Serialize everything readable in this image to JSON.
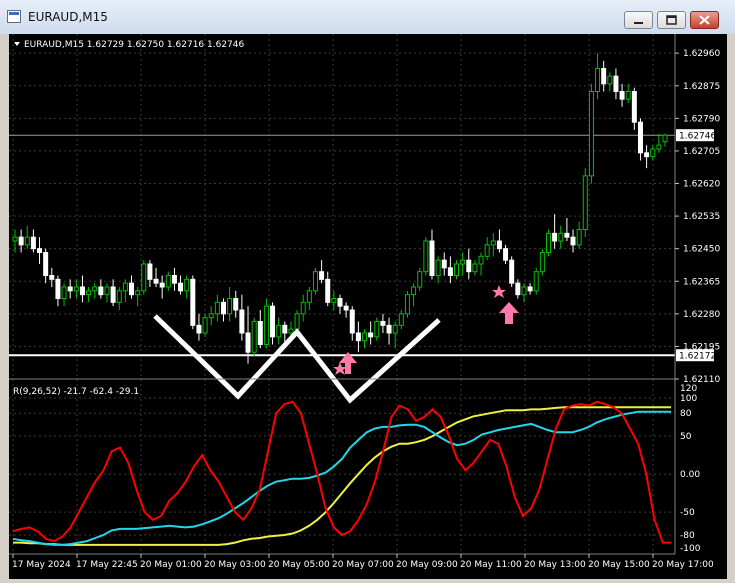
{
  "window": {
    "title": "EURAUD,M15"
  },
  "header": {
    "symbol_line": "EURAUD,M15  1.62729 1.62750 1.62716 1.62746"
  },
  "price_axis": {
    "labels": [
      "1.62960",
      "1.62875",
      "1.62790",
      "1.62705",
      "1.62620",
      "1.62535",
      "1.62450",
      "1.62365",
      "1.62280",
      "1.62195",
      "1.62110"
    ],
    "current_price": "1.62746",
    "line_price": "1.62172"
  },
  "indicator": {
    "header": "R(9,26,52) -21.7 -62.4 -29.1",
    "axis_labels": [
      "120",
      "100",
      "80",
      "50",
      "0.00",
      "-50",
      "-80",
      "-100"
    ]
  },
  "time_axis": {
    "labels": [
      "17 May 2024",
      "17 May 22:45",
      "20 May 01:00",
      "20 May 03:00",
      "20 May 05:00",
      "20 May 07:00",
      "20 May 09:00",
      "20 May 11:00",
      "20 May 13:00",
      "20 May 15:00",
      "20 May 17:00"
    ]
  },
  "colors": {
    "background": "#000000",
    "bull_candle": "#00c000",
    "bear_candle": "#ffffff",
    "grid": "#3a3a3a",
    "series_red": "#ff0000",
    "series_cyan": "#20d8e8",
    "series_yellow": "#f0f040",
    "arrow": "#ff7aa8"
  },
  "chart_data": [
    {
      "type": "candlestick",
      "title": "EURAUD,M15",
      "ylim": [
        1.6211,
        1.6301
      ],
      "ohlc": [
        [
          1.6247,
          1.625,
          1.6244,
          1.6248
        ],
        [
          1.6248,
          1.625,
          1.6244,
          1.6246
        ],
        [
          1.6246,
          1.6251,
          1.6245,
          1.6248
        ],
        [
          1.6248,
          1.625,
          1.6244,
          1.6245
        ],
        [
          1.6245,
          1.6248,
          1.6241,
          1.6244
        ],
        [
          1.6244,
          1.6245,
          1.6236,
          1.6238
        ],
        [
          1.6238,
          1.624,
          1.6235,
          1.6237
        ],
        [
          1.6237,
          1.6238,
          1.623,
          1.6232
        ],
        [
          1.6232,
          1.6236,
          1.623,
          1.6235
        ],
        [
          1.6235,
          1.6237,
          1.6232,
          1.6234
        ],
        [
          1.6234,
          1.6237,
          1.6232,
          1.6235
        ],
        [
          1.6235,
          1.6238,
          1.6231,
          1.6233
        ],
        [
          1.6233,
          1.6235,
          1.6231,
          1.6234
        ],
        [
          1.6234,
          1.6236,
          1.6232,
          1.6235
        ],
        [
          1.6235,
          1.6237,
          1.6232,
          1.6233
        ],
        [
          1.6233,
          1.6236,
          1.6231,
          1.6235
        ],
        [
          1.6235,
          1.6237,
          1.623,
          1.6231
        ],
        [
          1.6231,
          1.6235,
          1.6229,
          1.6234
        ],
        [
          1.6234,
          1.6237,
          1.6231,
          1.6236
        ],
        [
          1.6236,
          1.6238,
          1.6232,
          1.6233
        ],
        [
          1.6233,
          1.6235,
          1.623,
          1.6234
        ],
        [
          1.6234,
          1.6242,
          1.6233,
          1.6241
        ],
        [
          1.6241,
          1.6242,
          1.6235,
          1.6237
        ],
        [
          1.6237,
          1.624,
          1.6235,
          1.6236
        ],
        [
          1.6236,
          1.6238,
          1.6232,
          1.6235
        ],
        [
          1.6235,
          1.6239,
          1.6234,
          1.6238
        ],
        [
          1.6238,
          1.624,
          1.6234,
          1.6236
        ],
        [
          1.6236,
          1.6238,
          1.6233,
          1.6234
        ],
        [
          1.6234,
          1.6238,
          1.6232,
          1.6237
        ],
        [
          1.6237,
          1.6238,
          1.6224,
          1.6225
        ],
        [
          1.6225,
          1.6228,
          1.6221,
          1.6223
        ],
        [
          1.6223,
          1.6228,
          1.6222,
          1.6227
        ],
        [
          1.6227,
          1.623,
          1.6225,
          1.6228
        ],
        [
          1.6228,
          1.6233,
          1.6226,
          1.6231
        ],
        [
          1.6231,
          1.6232,
          1.6226,
          1.6228
        ],
        [
          1.6228,
          1.6235,
          1.6226,
          1.6232
        ],
        [
          1.6232,
          1.6234,
          1.6227,
          1.6229
        ],
        [
          1.6229,
          1.6233,
          1.6221,
          1.6223
        ],
        [
          1.6223,
          1.623,
          1.6215,
          1.6218
        ],
        [
          1.6218,
          1.6227,
          1.6217,
          1.6226
        ],
        [
          1.6226,
          1.6229,
          1.6219,
          1.622
        ],
        [
          1.622,
          1.6232,
          1.6219,
          1.623
        ],
        [
          1.623,
          1.6231,
          1.622,
          1.6222
        ],
        [
          1.6222,
          1.6227,
          1.622,
          1.6225
        ],
        [
          1.6225,
          1.6226,
          1.622,
          1.6223
        ],
        [
          1.6223,
          1.6226,
          1.6221,
          1.6224
        ],
        [
          1.6224,
          1.6229,
          1.6223,
          1.6228
        ],
        [
          1.6228,
          1.6233,
          1.6226,
          1.6231
        ],
        [
          1.6231,
          1.6235,
          1.6229,
          1.6234
        ],
        [
          1.6234,
          1.624,
          1.6233,
          1.6239
        ],
        [
          1.6239,
          1.6242,
          1.6236,
          1.6237
        ],
        [
          1.6237,
          1.6239,
          1.623,
          1.6231
        ],
        [
          1.6231,
          1.6234,
          1.6229,
          1.6232
        ],
        [
          1.6232,
          1.6233,
          1.6228,
          1.623
        ],
        [
          1.623,
          1.6231,
          1.6227,
          1.6229
        ],
        [
          1.6229,
          1.623,
          1.6221,
          1.6223
        ],
        [
          1.6223,
          1.6226,
          1.6218,
          1.6221
        ],
        [
          1.6221,
          1.6224,
          1.6219,
          1.6223
        ],
        [
          1.6223,
          1.6226,
          1.622,
          1.6222
        ],
        [
          1.6222,
          1.6227,
          1.6221,
          1.6226
        ],
        [
          1.6226,
          1.6228,
          1.6223,
          1.6225
        ],
        [
          1.6225,
          1.6227,
          1.622,
          1.6223
        ],
        [
          1.6223,
          1.6226,
          1.6219,
          1.6225
        ],
        [
          1.6225,
          1.6229,
          1.6224,
          1.6228
        ],
        [
          1.6228,
          1.6234,
          1.6227,
          1.6233
        ],
        [
          1.6233,
          1.6236,
          1.623,
          1.6235
        ],
        [
          1.6235,
          1.624,
          1.6234,
          1.6239
        ],
        [
          1.6239,
          1.6248,
          1.6238,
          1.6247
        ],
        [
          1.6247,
          1.625,
          1.6237,
          1.6238
        ],
        [
          1.6238,
          1.6243,
          1.6236,
          1.6242
        ],
        [
          1.6242,
          1.6244,
          1.6238,
          1.624
        ],
        [
          1.624,
          1.6243,
          1.6236,
          1.6238
        ],
        [
          1.6238,
          1.6242,
          1.6237,
          1.6241
        ],
        [
          1.6241,
          1.6244,
          1.6238,
          1.6242
        ],
        [
          1.6242,
          1.6245,
          1.6237,
          1.6239
        ],
        [
          1.6239,
          1.6242,
          1.6238,
          1.6241
        ],
        [
          1.6241,
          1.6244,
          1.6238,
          1.6243
        ],
        [
          1.6243,
          1.6248,
          1.6242,
          1.6246
        ],
        [
          1.6246,
          1.6249,
          1.6243,
          1.6247
        ],
        [
          1.6247,
          1.625,
          1.6244,
          1.6245
        ],
        [
          1.6245,
          1.6246,
          1.6241,
          1.6242
        ],
        [
          1.6242,
          1.6243,
          1.6235,
          1.6236
        ],
        [
          1.6236,
          1.6237,
          1.6232,
          1.6233
        ],
        [
          1.6233,
          1.6236,
          1.6231,
          1.6235
        ],
        [
          1.6235,
          1.6236,
          1.6233,
          1.6234
        ],
        [
          1.6234,
          1.624,
          1.6233,
          1.6239
        ],
        [
          1.6239,
          1.6245,
          1.6238,
          1.6244
        ],
        [
          1.6244,
          1.625,
          1.6243,
          1.6249
        ],
        [
          1.6249,
          1.6254,
          1.6245,
          1.6247
        ],
        [
          1.6247,
          1.6251,
          1.6245,
          1.6249
        ],
        [
          1.6249,
          1.6253,
          1.6247,
          1.6248
        ],
        [
          1.6248,
          1.625,
          1.6244,
          1.6246
        ],
        [
          1.6246,
          1.6252,
          1.6245,
          1.625
        ],
        [
          1.625,
          1.6266,
          1.6248,
          1.6264
        ],
        [
          1.6264,
          1.6288,
          1.6262,
          1.6286
        ],
        [
          1.6286,
          1.6296,
          1.6284,
          1.6292
        ],
        [
          1.6292,
          1.6294,
          1.6286,
          1.6288
        ],
        [
          1.6288,
          1.6291,
          1.6286,
          1.629
        ],
        [
          1.629,
          1.6292,
          1.6284,
          1.6286
        ],
        [
          1.6286,
          1.6288,
          1.6282,
          1.6284
        ],
        [
          1.6284,
          1.6288,
          1.6283,
          1.6286
        ],
        [
          1.6286,
          1.6287,
          1.6276,
          1.6278
        ],
        [
          1.6278,
          1.6279,
          1.6268,
          1.627
        ],
        [
          1.627,
          1.6272,
          1.6266,
          1.6269
        ],
        [
          1.6269,
          1.6272,
          1.6268,
          1.6271
        ],
        [
          1.6271,
          1.6275,
          1.627,
          1.6272
        ],
        [
          1.62729,
          1.6275,
          1.62716,
          1.62746
        ]
      ],
      "horizontal_lines": [
        1.62746,
        1.62172
      ]
    },
    {
      "type": "line",
      "title": "R(9,26,52) -21.7 -62.4 -29.1",
      "ylim": [
        -105,
        125
      ],
      "series": [
        {
          "values": [
            -75,
            -72,
            -70,
            -75,
            -85,
            -88,
            -82,
            -70,
            -50,
            -30,
            -10,
            5,
            30,
            35,
            15,
            -20,
            -50,
            -60,
            -55,
            -35,
            -25,
            -10,
            10,
            25,
            5,
            -10,
            -30,
            -50,
            -60,
            -45,
            -20,
            30,
            80,
            92,
            95,
            80,
            40,
            0,
            -45,
            -70,
            -80,
            -75,
            -60,
            -40,
            -10,
            30,
            75,
            90,
            85,
            70,
            75,
            85,
            75,
            50,
            20,
            5,
            15,
            30,
            45,
            40,
            10,
            -30,
            -55,
            -45,
            -20,
            20,
            60,
            85,
            90,
            92,
            90,
            95,
            92,
            88,
            80,
            60,
            40,
            0,
            -60,
            -90,
            -90
          ]
        },
        {
          "values": [
            -85,
            -87,
            -88,
            -90,
            -92,
            -93,
            -93,
            -92,
            -90,
            -88,
            -84,
            -80,
            -74,
            -72,
            -72,
            -72,
            -71,
            -70,
            -69,
            -68,
            -69,
            -70,
            -69,
            -66,
            -62,
            -58,
            -52,
            -45,
            -38,
            -30,
            -22,
            -15,
            -10,
            -8,
            -6,
            -6,
            -5,
            -2,
            2,
            10,
            20,
            35,
            45,
            55,
            60,
            62,
            62,
            64,
            65,
            65,
            62,
            55,
            48,
            42,
            38,
            40,
            45,
            52,
            55,
            58,
            60,
            62,
            64,
            66,
            62,
            58,
            55,
            55,
            55,
            58,
            62,
            68,
            72,
            75,
            78,
            80,
            82,
            82,
            82,
            82,
            82
          ]
        },
        {
          "values": [
            -90,
            -90,
            -91,
            -91,
            -92,
            -92,
            -93,
            -93,
            -93,
            -93,
            -93,
            -93,
            -93,
            -93,
            -93,
            -93,
            -93,
            -93,
            -93,
            -93,
            -93,
            -93,
            -93,
            -93,
            -93,
            -93,
            -92,
            -90,
            -87,
            -85,
            -84,
            -82,
            -81,
            -80,
            -78,
            -74,
            -68,
            -60,
            -50,
            -38,
            -25,
            -12,
            0,
            12,
            22,
            30,
            36,
            40,
            40,
            42,
            45,
            50,
            56,
            62,
            68,
            72,
            76,
            78,
            80,
            82,
            84,
            84,
            84,
            85,
            85,
            86,
            87,
            88,
            88,
            88,
            88,
            88,
            88,
            88,
            88,
            88,
            88,
            88,
            88,
            88,
            88
          ]
        }
      ]
    }
  ]
}
